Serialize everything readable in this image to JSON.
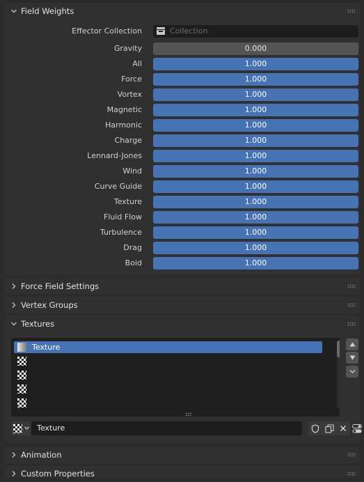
{
  "field_weights": {
    "title": "Field Weights",
    "effector_label": "Effector Collection",
    "effector_placeholder": "Collection",
    "gravity": {
      "label": "Gravity",
      "value": "0.000"
    },
    "weights": [
      {
        "label": "All",
        "value": "1.000"
      },
      {
        "label": "Force",
        "value": "1.000"
      },
      {
        "label": "Vortex",
        "value": "1.000"
      },
      {
        "label": "Magnetic",
        "value": "1.000"
      },
      {
        "label": "Harmonic",
        "value": "1.000"
      },
      {
        "label": "Charge",
        "value": "1.000"
      },
      {
        "label": "Lennard-Jones",
        "value": "1.000"
      },
      {
        "label": "Wind",
        "value": "1.000"
      },
      {
        "label": "Curve Guide",
        "value": "1.000"
      },
      {
        "label": "Texture",
        "value": "1.000"
      },
      {
        "label": "Fluid Flow",
        "value": "1.000"
      },
      {
        "label": "Turbulence",
        "value": "1.000"
      },
      {
        "label": "Drag",
        "value": "1.000"
      },
      {
        "label": "Boid",
        "value": "1.000"
      }
    ]
  },
  "panels": {
    "force_field_settings": "Force Field Settings",
    "vertex_groups": "Vertex Groups",
    "animation": "Animation",
    "custom_properties": "Custom Properties"
  },
  "textures": {
    "title": "Textures",
    "list_items": [
      "Texture",
      "",
      "",
      "",
      ""
    ],
    "selected_texture": "Texture"
  },
  "colors": {
    "accent": "#4772b3",
    "background": "#2b2b2b",
    "panel": "#303030",
    "field_gray": "#545454"
  },
  "icons": {
    "expanded": "chevron-down-icon",
    "collapsed": "chevron-right-icon",
    "collection": "collection-icon",
    "texture_thumb": "checker-icon",
    "fake_user": "shield-icon",
    "duplicate": "duplicate-icon",
    "unlink": "close-icon",
    "settings": "toggle-icon"
  }
}
